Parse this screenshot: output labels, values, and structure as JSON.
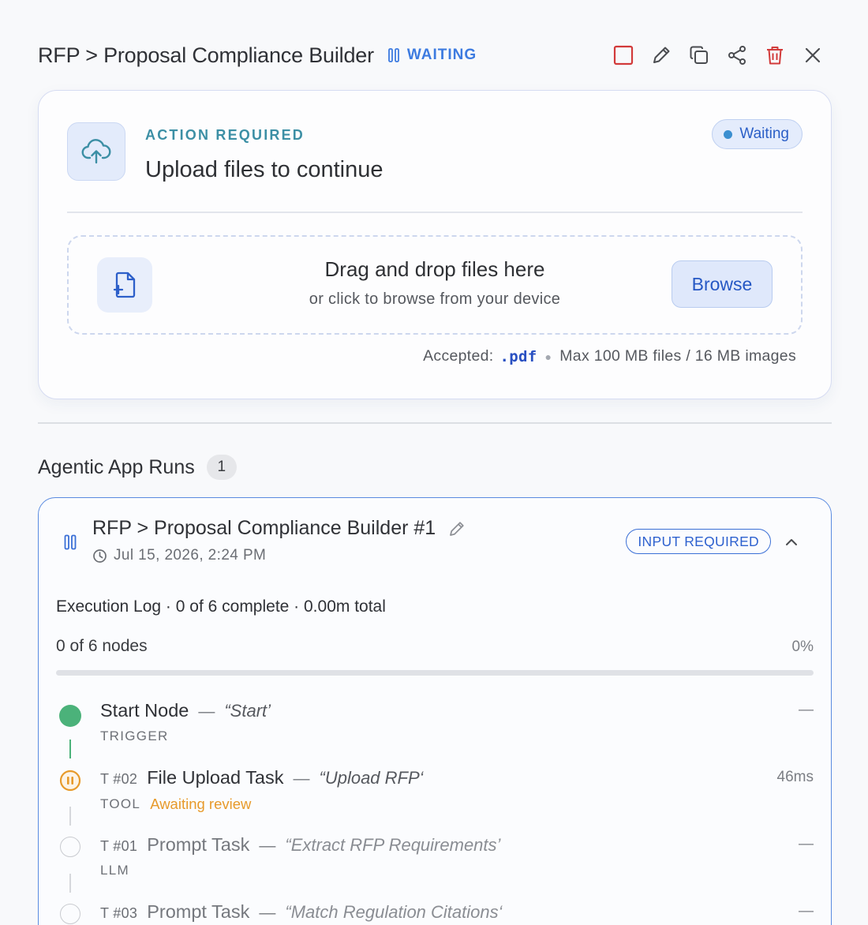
{
  "header": {
    "title": "RFP > Proposal Compliance Builder",
    "status": "WAITING",
    "accent_color": "#3d7be0"
  },
  "toolbar": {
    "icons": [
      "stop-icon",
      "pencil-icon",
      "copy-icon",
      "share-icon",
      "trash-icon",
      "close-icon"
    ]
  },
  "action_card": {
    "label": "ACTION REQUIRED",
    "title": "Upload files to continue",
    "status_chip": "Waiting",
    "dropzone": {
      "title": "Drag and drop files here",
      "subtitle": "or click to browse from your device",
      "browse_label": "Browse"
    },
    "accepted_label": "Accepted:",
    "accepted_ext": ".pdf",
    "limits": "Max 100 MB files / 16 MB images"
  },
  "runs": {
    "title": "Agentic App Runs",
    "count": "1",
    "run": {
      "name": "RFP > Proposal Compliance Builder #1",
      "date": "Jul 15, 2026, 2:24 PM",
      "badge": "INPUT REQUIRED",
      "execution_log": "Execution Log · 0 of 6 complete · 0.00m total",
      "nodes_label": "0 of 6 nodes",
      "progress_text": "0%",
      "progress": 0,
      "nodes": [
        {
          "num": "",
          "name": "Start Node",
          "quote": "“Start’",
          "type": "TRIGGER",
          "sub": "",
          "duration": "—",
          "state": "complete"
        },
        {
          "num": "T #02",
          "name": "File Upload Task",
          "quote": "“Upload RFP‘",
          "type": "TOOL",
          "sub": "Awaiting review",
          "duration": "46ms",
          "state": "paused"
        },
        {
          "num": "T #01",
          "name": "Prompt Task",
          "quote": "“Extract RFP Requirements’",
          "type": "LLM",
          "sub": "",
          "duration": "—",
          "state": "pending"
        },
        {
          "num": "T #03",
          "name": "Prompt Task",
          "quote": "“Match Regulation Citations‘",
          "type": "",
          "sub": "",
          "duration": "—",
          "state": "pending"
        }
      ]
    }
  }
}
